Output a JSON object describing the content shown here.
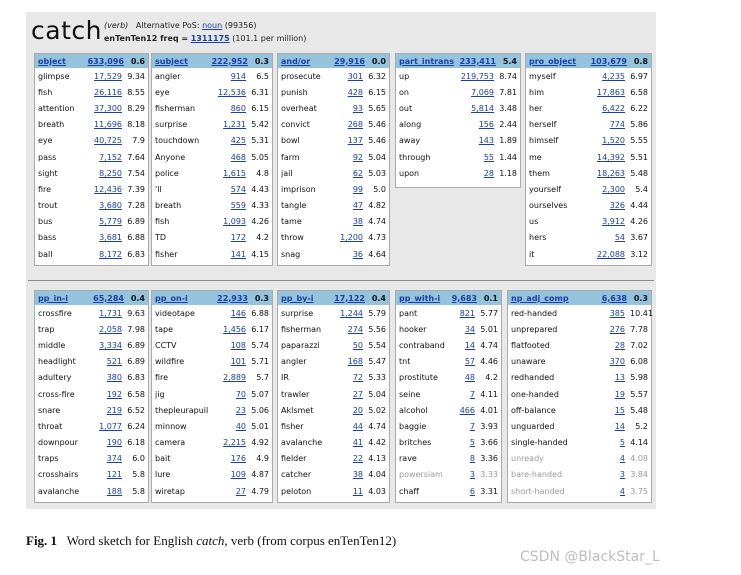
{
  "header": {
    "headword": "catch",
    "pos_label": "(verb)",
    "alt_pos_label": "Alternative PoS:",
    "alt_pos_value": "noun",
    "alt_pos_count": "(99356)",
    "corpus_label": "enTenTen12 freq =",
    "corpus_freq": "1311175",
    "per_million": "(101.1 per million)"
  },
  "grammar_rows": [
    [
      {
        "rel": "object",
        "freq": "633,096",
        "score": "0.6",
        "items": [
          [
            "glimpse",
            "17,529",
            "9.34"
          ],
          [
            "fish",
            "26,116",
            "8.55"
          ],
          [
            "attention",
            "37,300",
            "8.29"
          ],
          [
            "breath",
            "11,696",
            "8.18"
          ],
          [
            "eye",
            "40,725",
            "7.9"
          ],
          [
            "pass",
            "7,152",
            "7.64"
          ],
          [
            "sight",
            "8,250",
            "7.54"
          ],
          [
            "fire",
            "12,436",
            "7.39"
          ],
          [
            "trout",
            "3,680",
            "7.28"
          ],
          [
            "bus",
            "5,779",
            "6.89"
          ],
          [
            "bass",
            "3,681",
            "6.88"
          ],
          [
            "ball",
            "8,172",
            "6.83"
          ]
        ]
      },
      {
        "rel": "subject",
        "freq": "222,952",
        "score": "0.3",
        "items": [
          [
            "angler",
            "914",
            "6.5"
          ],
          [
            "eye",
            "12,536",
            "6.31"
          ],
          [
            "fisherman",
            "860",
            "6.15"
          ],
          [
            "surprise",
            "1,231",
            "5.42"
          ],
          [
            "touchdown",
            "425",
            "5.31"
          ],
          [
            "Anyone",
            "468",
            "5.05"
          ],
          [
            "police",
            "1,615",
            "4.8"
          ],
          [
            "'ll",
            "574",
            "4.43"
          ],
          [
            "breath",
            "559",
            "4.33"
          ],
          [
            "fish",
            "1,093",
            "4.26"
          ],
          [
            "TD",
            "172",
            "4.2"
          ],
          [
            "fisher",
            "141",
            "4.15"
          ]
        ]
      },
      {
        "rel": "and/or",
        "freq": "29,916",
        "score": "0.0",
        "items": [
          [
            "prosecute",
            "301",
            "6.32"
          ],
          [
            "punish",
            "428",
            "6.15"
          ],
          [
            "overheat",
            "93",
            "5.65"
          ],
          [
            "convict",
            "268",
            "5.46"
          ],
          [
            "bowl",
            "137",
            "5.46"
          ],
          [
            "farm",
            "92",
            "5.04"
          ],
          [
            "jail",
            "62",
            "5.03"
          ],
          [
            "imprison",
            "99",
            "5.0"
          ],
          [
            "tangle",
            "47",
            "4.82"
          ],
          [
            "tame",
            "38",
            "4.74"
          ],
          [
            "throw",
            "1,200",
            "4.73"
          ],
          [
            "snag",
            "36",
            "4.64"
          ]
        ]
      },
      {
        "rel": "part_intrans",
        "freq": "233,411",
        "score": "5.4",
        "items": [
          [
            "up",
            "219,753",
            "8.74"
          ],
          [
            "on",
            "7,069",
            "7.81"
          ],
          [
            "out",
            "5,814",
            "3.48"
          ],
          [
            "along",
            "156",
            "2.44"
          ],
          [
            "away",
            "143",
            "1.89"
          ],
          [
            "through",
            "55",
            "1.44"
          ],
          [
            "upon",
            "28",
            "1.18"
          ]
        ]
      },
      {
        "rel": "pro_object",
        "freq": "103,679",
        "score": "0.8",
        "items": [
          [
            "myself",
            "4,235",
            "6.97"
          ],
          [
            "him",
            "17,863",
            "6.58"
          ],
          [
            "her",
            "6,422",
            "6.22"
          ],
          [
            "herself",
            "774",
            "5.86"
          ],
          [
            "himself",
            "1,520",
            "5.55"
          ],
          [
            "me",
            "14,392",
            "5.51"
          ],
          [
            "them",
            "18,263",
            "5.48"
          ],
          [
            "yourself",
            "2,300",
            "5.4"
          ],
          [
            "ourselves",
            "326",
            "4.44"
          ],
          [
            "us",
            "3,912",
            "4.26"
          ],
          [
            "hers",
            "54",
            "3.67"
          ],
          [
            "it",
            "22,088",
            "3.12"
          ]
        ]
      }
    ],
    [
      {
        "rel": "pp_in-i",
        "freq": "65,284",
        "score": "0.4",
        "items": [
          [
            "crossfire",
            "1,731",
            "9.63"
          ],
          [
            "trap",
            "2,058",
            "7.98"
          ],
          [
            "middle",
            "3,334",
            "6.89"
          ],
          [
            "headlight",
            "521",
            "6.89"
          ],
          [
            "adultery",
            "380",
            "6.83"
          ],
          [
            "cross-fire",
            "192",
            "6.58"
          ],
          [
            "snare",
            "219",
            "6.52"
          ],
          [
            "throat",
            "1,077",
            "6.24"
          ],
          [
            "downpour",
            "190",
            "6.18"
          ],
          [
            "traps",
            "374",
            "6.0"
          ],
          [
            "crosshairs",
            "121",
            "5.8"
          ],
          [
            "avalanche",
            "188",
            "5.8"
          ]
        ]
      },
      {
        "rel": "pp_on-i",
        "freq": "22,933",
        "score": "0.3",
        "items": [
          [
            "videotape",
            "146",
            "6.88"
          ],
          [
            "tape",
            "1,456",
            "6.17"
          ],
          [
            "CCTV",
            "108",
            "5.74"
          ],
          [
            "wildfire",
            "101",
            "5.71"
          ],
          [
            "fire",
            "2,889",
            "5.7"
          ],
          [
            "jig",
            "70",
            "5.07"
          ],
          [
            "thepleurapuil",
            "23",
            "5.06"
          ],
          [
            "minnow",
            "40",
            "5.01"
          ],
          [
            "camera",
            "2,215",
            "4.92"
          ],
          [
            "bait",
            "176",
            "4.9"
          ],
          [
            "lure",
            "109",
            "4.87"
          ],
          [
            "wiretap",
            "27",
            "4.79"
          ]
        ]
      },
      {
        "rel": "pp_by-i",
        "freq": "17,122",
        "score": "0.4",
        "items": [
          [
            "surprise",
            "1,244",
            "5.79"
          ],
          [
            "fisherman",
            "274",
            "5.56"
          ],
          [
            "paparazzi",
            "50",
            "5.54"
          ],
          [
            "angler",
            "168",
            "5.47"
          ],
          [
            "IR",
            "72",
            "5.33"
          ],
          [
            "trawler",
            "27",
            "5.04"
          ],
          [
            "Aklsmet",
            "20",
            "5.02"
          ],
          [
            "fisher",
            "44",
            "4.74"
          ],
          [
            "avalanche",
            "41",
            "4.42"
          ],
          [
            "fielder",
            "22",
            "4.13"
          ],
          [
            "catcher",
            "38",
            "4.04"
          ],
          [
            "peloton",
            "11",
            "4.03"
          ]
        ]
      },
      {
        "rel": "pp_with-i",
        "freq": "9,683",
        "score": "0.1",
        "items": [
          [
            "pant",
            "821",
            "5.77"
          ],
          [
            "hooker",
            "34",
            "5.01"
          ],
          [
            "contraband",
            "14",
            "4.74"
          ],
          [
            "tnt",
            "57",
            "4.46"
          ],
          [
            "prostitute",
            "48",
            "4.2"
          ],
          [
            "seine",
            "7",
            "4.11"
          ],
          [
            "alcohol",
            "466",
            "4.01"
          ],
          [
            "baggie",
            "7",
            "3.93"
          ],
          [
            "britches",
            "5",
            "3.66"
          ],
          [
            "rave",
            "8",
            "3.36"
          ],
          [
            "powersiam",
            "3",
            "3.33",
            "dim"
          ],
          [
            "chaff",
            "6",
            "3.31"
          ]
        ]
      },
      {
        "rel": "np_adj_comp",
        "freq": "6,638",
        "score": "0.3",
        "items": [
          [
            "red-handed",
            "385",
            "10.41"
          ],
          [
            "unprepared",
            "276",
            "7.78"
          ],
          [
            "flatfooted",
            "28",
            "7.02"
          ],
          [
            "unaware",
            "370",
            "6.08"
          ],
          [
            "redhanded",
            "13",
            "5.98"
          ],
          [
            "one-handed",
            "19",
            "5.57"
          ],
          [
            "off-balance",
            "15",
            "5.48"
          ],
          [
            "unguarded",
            "14",
            "5.2"
          ],
          [
            "single-handed",
            "5",
            "4.14"
          ],
          [
            "unready",
            "4",
            "4.08",
            "dim"
          ],
          [
            "bare-handed",
            "3",
            "3.84",
            "dim"
          ],
          [
            "short-handed",
            "4",
            "3.75",
            "dim"
          ]
        ]
      }
    ]
  ],
  "caption": {
    "fig": "Fig. 1",
    "text_before": "Word sketch for English",
    "text_italic": "catch",
    "text_after": ", verb (from corpus enTenTen12)"
  },
  "watermark": "CSDN @BlackStar_L",
  "colors": {
    "header_bg": "#94c3dc",
    "link": "#1a3fa8",
    "panel_bg": "#e8e8e8",
    "dim_text": "#9a9a9a"
  }
}
